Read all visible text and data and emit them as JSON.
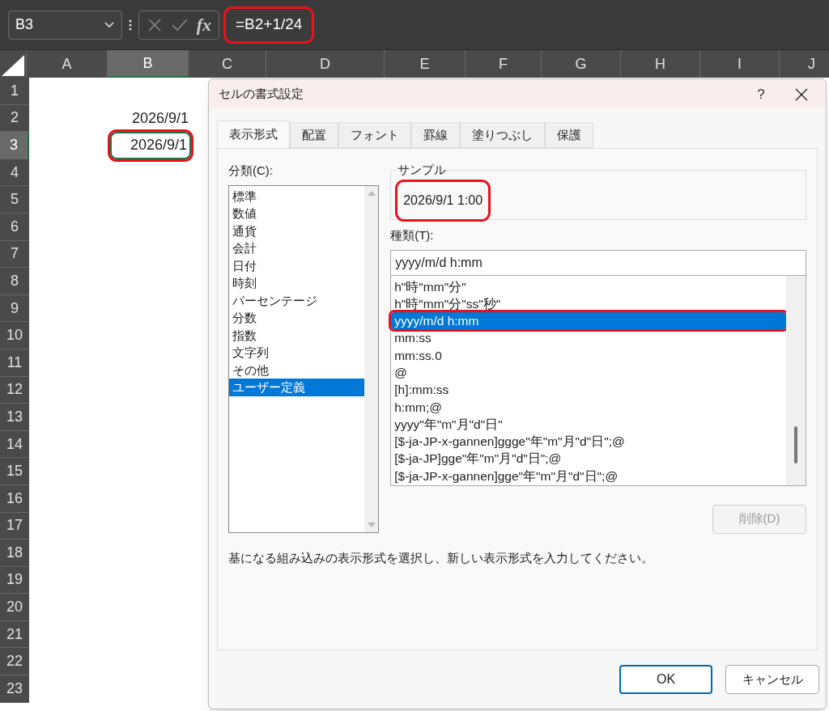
{
  "name_box": {
    "value": "B3"
  },
  "formula_bar": {
    "fx": "fx",
    "formula": "=B2+1/24",
    "highlighted": true
  },
  "columns": [
    {
      "label": "A",
      "selected": false
    },
    {
      "label": "B",
      "selected": true
    },
    {
      "label": "C",
      "selected": false
    },
    {
      "label": "D",
      "selected": false
    },
    {
      "label": "E",
      "selected": false
    },
    {
      "label": "F",
      "selected": false
    },
    {
      "label": "G",
      "selected": false
    },
    {
      "label": "H",
      "selected": false
    },
    {
      "label": "I",
      "selected": false
    },
    {
      "label": "J",
      "selected": false
    }
  ],
  "rows": [
    {
      "label": "1",
      "selected": false,
      "cell_b": null
    },
    {
      "label": "2",
      "selected": false,
      "cell_b": {
        "text": "2026/9/1",
        "selected": false,
        "highlighted": false
      }
    },
    {
      "label": "3",
      "selected": true,
      "cell_b": {
        "text": "2026/9/1",
        "selected": true,
        "highlighted": true
      }
    },
    {
      "label": "4",
      "selected": false,
      "cell_b": null
    },
    {
      "label": "5",
      "selected": false,
      "cell_b": null
    },
    {
      "label": "6",
      "selected": false,
      "cell_b": null
    },
    {
      "label": "7",
      "selected": false,
      "cell_b": null
    },
    {
      "label": "8",
      "selected": false,
      "cell_b": null
    },
    {
      "label": "9",
      "selected": false,
      "cell_b": null
    },
    {
      "label": "10",
      "selected": false,
      "cell_b": null
    },
    {
      "label": "11",
      "selected": false,
      "cell_b": null
    },
    {
      "label": "12",
      "selected": false,
      "cell_b": null
    },
    {
      "label": "13",
      "selected": false,
      "cell_b": null
    },
    {
      "label": "14",
      "selected": false,
      "cell_b": null
    },
    {
      "label": "15",
      "selected": false,
      "cell_b": null
    },
    {
      "label": "16",
      "selected": false,
      "cell_b": null
    },
    {
      "label": "17",
      "selected": false,
      "cell_b": null
    },
    {
      "label": "18",
      "selected": false,
      "cell_b": null
    },
    {
      "label": "19",
      "selected": false,
      "cell_b": null
    },
    {
      "label": "20",
      "selected": false,
      "cell_b": null
    },
    {
      "label": "21",
      "selected": false,
      "cell_b": null
    },
    {
      "label": "22",
      "selected": false,
      "cell_b": null
    },
    {
      "label": "23",
      "selected": false,
      "cell_b": null
    }
  ],
  "dialog": {
    "title": "セルの書式設定",
    "help": "?",
    "tabs": [
      {
        "label": "表示形式",
        "selected": true
      },
      {
        "label": "配置",
        "selected": false
      },
      {
        "label": "フォント",
        "selected": false
      },
      {
        "label": "罫線",
        "selected": false
      },
      {
        "label": "塗りつぶし",
        "selected": false
      },
      {
        "label": "保護",
        "selected": false
      }
    ],
    "category_label": "分類(C):",
    "categories": [
      {
        "label": "標準",
        "selected": false
      },
      {
        "label": "数値",
        "selected": false
      },
      {
        "label": "通貨",
        "selected": false
      },
      {
        "label": "会計",
        "selected": false
      },
      {
        "label": "日付",
        "selected": false
      },
      {
        "label": "時刻",
        "selected": false
      },
      {
        "label": "パーセンテージ",
        "selected": false
      },
      {
        "label": "分数",
        "selected": false
      },
      {
        "label": "指数",
        "selected": false
      },
      {
        "label": "文字列",
        "selected": false
      },
      {
        "label": "その他",
        "selected": false
      },
      {
        "label": "ユーザー定義",
        "selected": true
      }
    ],
    "sample": {
      "label": "サンプル",
      "value": "2026/9/1 1:00",
      "highlighted": true
    },
    "type_label": "種類(T):",
    "type_input": {
      "value": "yyyy/m/d h:mm"
    },
    "formats": [
      {
        "label": "h\"時\"mm\"分\"",
        "selected": false,
        "highlighted": false
      },
      {
        "label": "h\"時\"mm\"分\"ss\"秒\"",
        "selected": false,
        "highlighted": false
      },
      {
        "label": "yyyy/m/d h:mm",
        "selected": true,
        "highlighted": true
      },
      {
        "label": "mm:ss",
        "selected": false,
        "highlighted": false
      },
      {
        "label": "mm:ss.0",
        "selected": false,
        "highlighted": false
      },
      {
        "label": "@",
        "selected": false,
        "highlighted": false
      },
      {
        "label": "[h]:mm:ss",
        "selected": false,
        "highlighted": false
      },
      {
        "label": "h:mm;@",
        "selected": false,
        "highlighted": false
      },
      {
        "label": "yyyy\"年\"m\"月\"d\"日\"",
        "selected": false,
        "highlighted": false
      },
      {
        "label": "[$-ja-JP-x-gannen]ggge\"年\"m\"月\"d\"日\";@",
        "selected": false,
        "highlighted": false
      },
      {
        "label": "[$-ja-JP]gge\"年\"m\"月\"d\"日\";@",
        "selected": false,
        "highlighted": false
      },
      {
        "label": "[$-ja-JP-x-gannen]gge\"年\"m\"月\"d\"日\";@",
        "selected": false,
        "highlighted": false
      }
    ],
    "delete_button": {
      "label": "削除(D)",
      "disabled": true
    },
    "description": "基になる組み込みの表示形式を選択し、新しい表示形式を入力してください。",
    "ok_button": "OK",
    "cancel_button": "キャンセル"
  }
}
